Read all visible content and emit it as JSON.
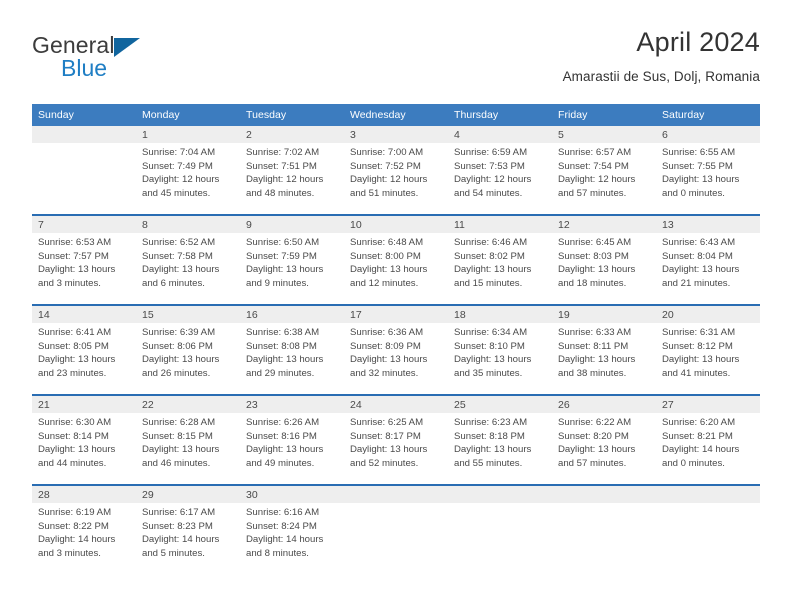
{
  "brand": {
    "name_part1": "General",
    "name_part2": "Blue",
    "logo_icon": "blue-triangle-icon"
  },
  "header": {
    "title": "April 2024",
    "subtitle": "Amarastii de Sus, Dolj, Romania"
  },
  "colors": {
    "header_row": "#3c7cbf",
    "row_separator": "#2a6db3",
    "daynum_band": "#eeeeee",
    "brand_blue": "#1f7ec4",
    "text": "#4a4a4a"
  },
  "weekday_headers": [
    "Sunday",
    "Monday",
    "Tuesday",
    "Wednesday",
    "Thursday",
    "Friday",
    "Saturday"
  ],
  "weeks": [
    [
      {
        "day": "",
        "empty": true,
        "sunrise": "",
        "sunset": "",
        "daylight1": "",
        "daylight2": ""
      },
      {
        "day": "1",
        "sunrise": "Sunrise: 7:04 AM",
        "sunset": "Sunset: 7:49 PM",
        "daylight1": "Daylight: 12 hours",
        "daylight2": "and 45 minutes."
      },
      {
        "day": "2",
        "sunrise": "Sunrise: 7:02 AM",
        "sunset": "Sunset: 7:51 PM",
        "daylight1": "Daylight: 12 hours",
        "daylight2": "and 48 minutes."
      },
      {
        "day": "3",
        "sunrise": "Sunrise: 7:00 AM",
        "sunset": "Sunset: 7:52 PM",
        "daylight1": "Daylight: 12 hours",
        "daylight2": "and 51 minutes."
      },
      {
        "day": "4",
        "sunrise": "Sunrise: 6:59 AM",
        "sunset": "Sunset: 7:53 PM",
        "daylight1": "Daylight: 12 hours",
        "daylight2": "and 54 minutes."
      },
      {
        "day": "5",
        "sunrise": "Sunrise: 6:57 AM",
        "sunset": "Sunset: 7:54 PM",
        "daylight1": "Daylight: 12 hours",
        "daylight2": "and 57 minutes."
      },
      {
        "day": "6",
        "sunrise": "Sunrise: 6:55 AM",
        "sunset": "Sunset: 7:55 PM",
        "daylight1": "Daylight: 13 hours",
        "daylight2": "and 0 minutes."
      }
    ],
    [
      {
        "day": "7",
        "sunrise": "Sunrise: 6:53 AM",
        "sunset": "Sunset: 7:57 PM",
        "daylight1": "Daylight: 13 hours",
        "daylight2": "and 3 minutes."
      },
      {
        "day": "8",
        "sunrise": "Sunrise: 6:52 AM",
        "sunset": "Sunset: 7:58 PM",
        "daylight1": "Daylight: 13 hours",
        "daylight2": "and 6 minutes."
      },
      {
        "day": "9",
        "sunrise": "Sunrise: 6:50 AM",
        "sunset": "Sunset: 7:59 PM",
        "daylight1": "Daylight: 13 hours",
        "daylight2": "and 9 minutes."
      },
      {
        "day": "10",
        "sunrise": "Sunrise: 6:48 AM",
        "sunset": "Sunset: 8:00 PM",
        "daylight1": "Daylight: 13 hours",
        "daylight2": "and 12 minutes."
      },
      {
        "day": "11",
        "sunrise": "Sunrise: 6:46 AM",
        "sunset": "Sunset: 8:02 PM",
        "daylight1": "Daylight: 13 hours",
        "daylight2": "and 15 minutes."
      },
      {
        "day": "12",
        "sunrise": "Sunrise: 6:45 AM",
        "sunset": "Sunset: 8:03 PM",
        "daylight1": "Daylight: 13 hours",
        "daylight2": "and 18 minutes."
      },
      {
        "day": "13",
        "sunrise": "Sunrise: 6:43 AM",
        "sunset": "Sunset: 8:04 PM",
        "daylight1": "Daylight: 13 hours",
        "daylight2": "and 21 minutes."
      }
    ],
    [
      {
        "day": "14",
        "sunrise": "Sunrise: 6:41 AM",
        "sunset": "Sunset: 8:05 PM",
        "daylight1": "Daylight: 13 hours",
        "daylight2": "and 23 minutes."
      },
      {
        "day": "15",
        "sunrise": "Sunrise: 6:39 AM",
        "sunset": "Sunset: 8:06 PM",
        "daylight1": "Daylight: 13 hours",
        "daylight2": "and 26 minutes."
      },
      {
        "day": "16",
        "sunrise": "Sunrise: 6:38 AM",
        "sunset": "Sunset: 8:08 PM",
        "daylight1": "Daylight: 13 hours",
        "daylight2": "and 29 minutes."
      },
      {
        "day": "17",
        "sunrise": "Sunrise: 6:36 AM",
        "sunset": "Sunset: 8:09 PM",
        "daylight1": "Daylight: 13 hours",
        "daylight2": "and 32 minutes."
      },
      {
        "day": "18",
        "sunrise": "Sunrise: 6:34 AM",
        "sunset": "Sunset: 8:10 PM",
        "daylight1": "Daylight: 13 hours",
        "daylight2": "and 35 minutes."
      },
      {
        "day": "19",
        "sunrise": "Sunrise: 6:33 AM",
        "sunset": "Sunset: 8:11 PM",
        "daylight1": "Daylight: 13 hours",
        "daylight2": "and 38 minutes."
      },
      {
        "day": "20",
        "sunrise": "Sunrise: 6:31 AM",
        "sunset": "Sunset: 8:12 PM",
        "daylight1": "Daylight: 13 hours",
        "daylight2": "and 41 minutes."
      }
    ],
    [
      {
        "day": "21",
        "sunrise": "Sunrise: 6:30 AM",
        "sunset": "Sunset: 8:14 PM",
        "daylight1": "Daylight: 13 hours",
        "daylight2": "and 44 minutes."
      },
      {
        "day": "22",
        "sunrise": "Sunrise: 6:28 AM",
        "sunset": "Sunset: 8:15 PM",
        "daylight1": "Daylight: 13 hours",
        "daylight2": "and 46 minutes."
      },
      {
        "day": "23",
        "sunrise": "Sunrise: 6:26 AM",
        "sunset": "Sunset: 8:16 PM",
        "daylight1": "Daylight: 13 hours",
        "daylight2": "and 49 minutes."
      },
      {
        "day": "24",
        "sunrise": "Sunrise: 6:25 AM",
        "sunset": "Sunset: 8:17 PM",
        "daylight1": "Daylight: 13 hours",
        "daylight2": "and 52 minutes."
      },
      {
        "day": "25",
        "sunrise": "Sunrise: 6:23 AM",
        "sunset": "Sunset: 8:18 PM",
        "daylight1": "Daylight: 13 hours",
        "daylight2": "and 55 minutes."
      },
      {
        "day": "26",
        "sunrise": "Sunrise: 6:22 AM",
        "sunset": "Sunset: 8:20 PM",
        "daylight1": "Daylight: 13 hours",
        "daylight2": "and 57 minutes."
      },
      {
        "day": "27",
        "sunrise": "Sunrise: 6:20 AM",
        "sunset": "Sunset: 8:21 PM",
        "daylight1": "Daylight: 14 hours",
        "daylight2": "and 0 minutes."
      }
    ],
    [
      {
        "day": "28",
        "sunrise": "Sunrise: 6:19 AM",
        "sunset": "Sunset: 8:22 PM",
        "daylight1": "Daylight: 14 hours",
        "daylight2": "and 3 minutes."
      },
      {
        "day": "29",
        "sunrise": "Sunrise: 6:17 AM",
        "sunset": "Sunset: 8:23 PM",
        "daylight1": "Daylight: 14 hours",
        "daylight2": "and 5 minutes."
      },
      {
        "day": "30",
        "sunrise": "Sunrise: 6:16 AM",
        "sunset": "Sunset: 8:24 PM",
        "daylight1": "Daylight: 14 hours",
        "daylight2": "and 8 minutes."
      },
      {
        "day": "",
        "empty": true,
        "sunrise": "",
        "sunset": "",
        "daylight1": "",
        "daylight2": ""
      },
      {
        "day": "",
        "empty": true,
        "sunrise": "",
        "sunset": "",
        "daylight1": "",
        "daylight2": ""
      },
      {
        "day": "",
        "empty": true,
        "sunrise": "",
        "sunset": "",
        "daylight1": "",
        "daylight2": ""
      },
      {
        "day": "",
        "empty": true,
        "sunrise": "",
        "sunset": "",
        "daylight1": "",
        "daylight2": ""
      }
    ]
  ]
}
